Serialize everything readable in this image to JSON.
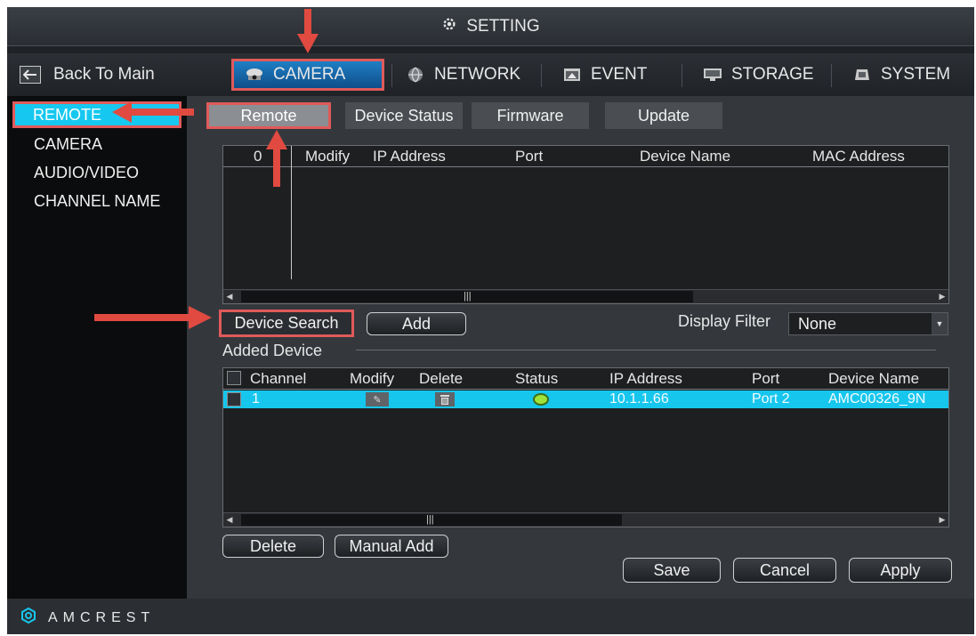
{
  "title": "SETTING",
  "nav": {
    "back_label": "Back To Main",
    "tabs": [
      "CAMERA",
      "NETWORK",
      "EVENT",
      "STORAGE",
      "SYSTEM"
    ]
  },
  "sidebar": {
    "items": [
      "REMOTE",
      "CAMERA",
      "AUDIO/VIDEO",
      "CHANNEL NAME"
    ]
  },
  "subtabs": [
    "Remote",
    "Device Status",
    "Firmware",
    "Update"
  ],
  "search_table": {
    "headers": [
      "0",
      "Modify",
      "IP Address",
      "Port",
      "Device Name",
      "MAC Address"
    ]
  },
  "buttons": {
    "device_search": "Device Search",
    "add": "Add",
    "delete": "Delete",
    "manual_add": "Manual Add",
    "save": "Save",
    "cancel": "Cancel",
    "apply": "Apply"
  },
  "display_filter": {
    "label": "Display Filter",
    "value": "None"
  },
  "added_device": {
    "label": "Added Device",
    "headers": [
      "Channel",
      "Modify",
      "Delete",
      "Status",
      "IP Address",
      "Port",
      "Device Name"
    ],
    "rows": [
      {
        "channel": "1",
        "ip": "10.1.1.66",
        "port": "Port 2",
        "device_name": "AMC00326_9N",
        "status_color": "#9ee23a"
      }
    ]
  },
  "brand": "AMCREST",
  "colors": {
    "accent": "#16c8ef",
    "highlight_outline": "#e05a5a",
    "annotation_arrow": "#e04a40"
  },
  "icons": [
    "gear-icon",
    "back-arrow-icon",
    "camera-icon",
    "network-icon",
    "event-icon",
    "storage-icon",
    "system-icon",
    "pencil-icon",
    "trash-icon",
    "status-dot-icon",
    "amcrest-logo-icon"
  ]
}
